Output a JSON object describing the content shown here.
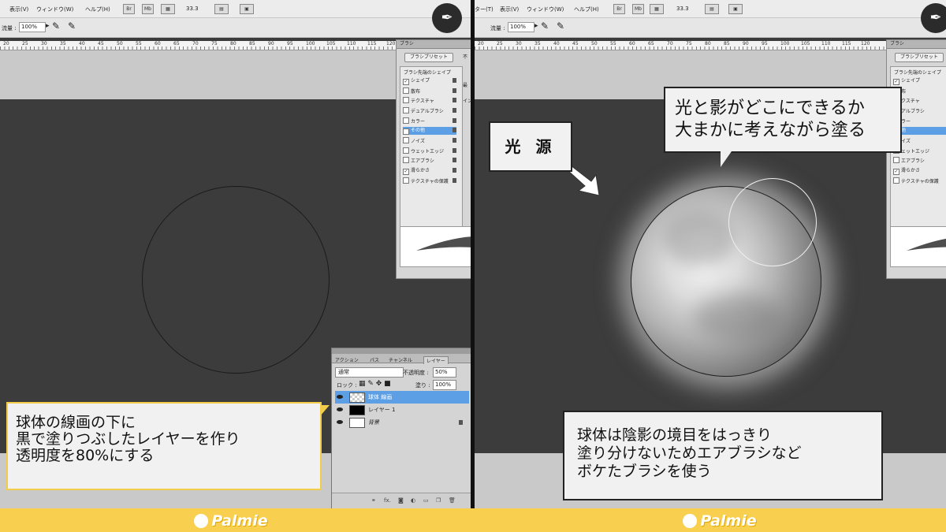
{
  "menu": {
    "left_items": [
      "表示(V)",
      "ウィンドウ(W)",
      "ヘルプ(H)"
    ],
    "right_items": [
      "ター(T)",
      "表示(V)",
      "ウィンドウ(W)",
      "ヘルプ(H)"
    ],
    "btn_br": "Br",
    "btn_mb": "Mb",
    "zoom": "33.3"
  },
  "tool_options": {
    "flow_label": "流量 :",
    "flow_value": "100%"
  },
  "ruler": {
    "ticks_left": [
      "20",
      "25",
      "30",
      "35",
      "40",
      "45",
      "50",
      "55",
      "60",
      "65",
      "70",
      "75",
      "80",
      "85",
      "90",
      "95",
      "100",
      "105",
      "110",
      "115",
      "120"
    ],
    "ticks_right": [
      "20",
      "25",
      "30",
      "35",
      "40",
      "45",
      "50",
      "55",
      "60",
      "65",
      "70",
      "75",
      "80",
      "85",
      "90",
      "95",
      "100",
      "105",
      "110",
      "115",
      "120"
    ]
  },
  "brush_panel": {
    "tab": "ブラシ",
    "preset_button": "ブラシプリセット",
    "group_header": "ブラシ先端のシェイプ",
    "items": [
      {
        "label": "シェイプ",
        "checked": "true"
      },
      {
        "label": "散布",
        "checked": "false"
      },
      {
        "label": "テクスチャ",
        "checked": "false"
      },
      {
        "label": "デュアルブラシ",
        "checked": "false"
      },
      {
        "label": "カラー",
        "checked": "false"
      },
      {
        "label": "その他",
        "checked": "true"
      },
      {
        "label": "ノイズ",
        "checked": "false"
      },
      {
        "label": "ウェットエッジ",
        "checked": "false"
      },
      {
        "label": "エアブラシ",
        "checked": "false"
      },
      {
        "label": "滑らかさ",
        "checked": "true"
      },
      {
        "label": "テクスチャの保護",
        "checked": "false"
      }
    ],
    "right_items": [
      {
        "label": "シェイプ"
      },
      {
        "label": "布"
      },
      {
        "label": "クスチャ"
      },
      {
        "label": "アルブラシ"
      },
      {
        "label": "ラー"
      },
      {
        "label": "他"
      },
      {
        "label": "イズ"
      },
      {
        "label": "ェットエッジ"
      },
      {
        "label": "エアブラシ"
      },
      {
        "label": "滑らかさ"
      },
      {
        "label": "テクスチャの保護"
      }
    ],
    "side_labels": [
      "不",
      "最",
      "イン"
    ]
  },
  "layers_panel": {
    "tabs": [
      "アクション",
      "パス",
      "チャンネル",
      "レイヤー"
    ],
    "blend_mode": "通常",
    "opacity_label": "不透明度 :",
    "opacity_value": "50%",
    "lock_label": "ロック :",
    "fill_label": "塗り :",
    "fill_value": "100%",
    "layers": [
      {
        "name": "球体 線画"
      },
      {
        "name": "レイヤー 1"
      },
      {
        "name": "背景"
      }
    ],
    "bottom_fx": "fx."
  },
  "callouts": {
    "left_lines": [
      "球体の線画の下に",
      "黒で塗りつぶしたレイヤーを作り",
      "透明度を80%にする"
    ],
    "light_source": "光 源",
    "shade_lines": [
      "光と影がどこにできるか",
      "大まかに考えながら塗る"
    ],
    "brush_lines": [
      "球体は陰影の境目をはっきり",
      "塗り分けないためエアブラシなど",
      "ボケたブラシを使う"
    ]
  },
  "brand": {
    "logo_text": "Palmie",
    "accent_color": "#f9cf4f",
    "selection_color": "#5c9fe5"
  }
}
